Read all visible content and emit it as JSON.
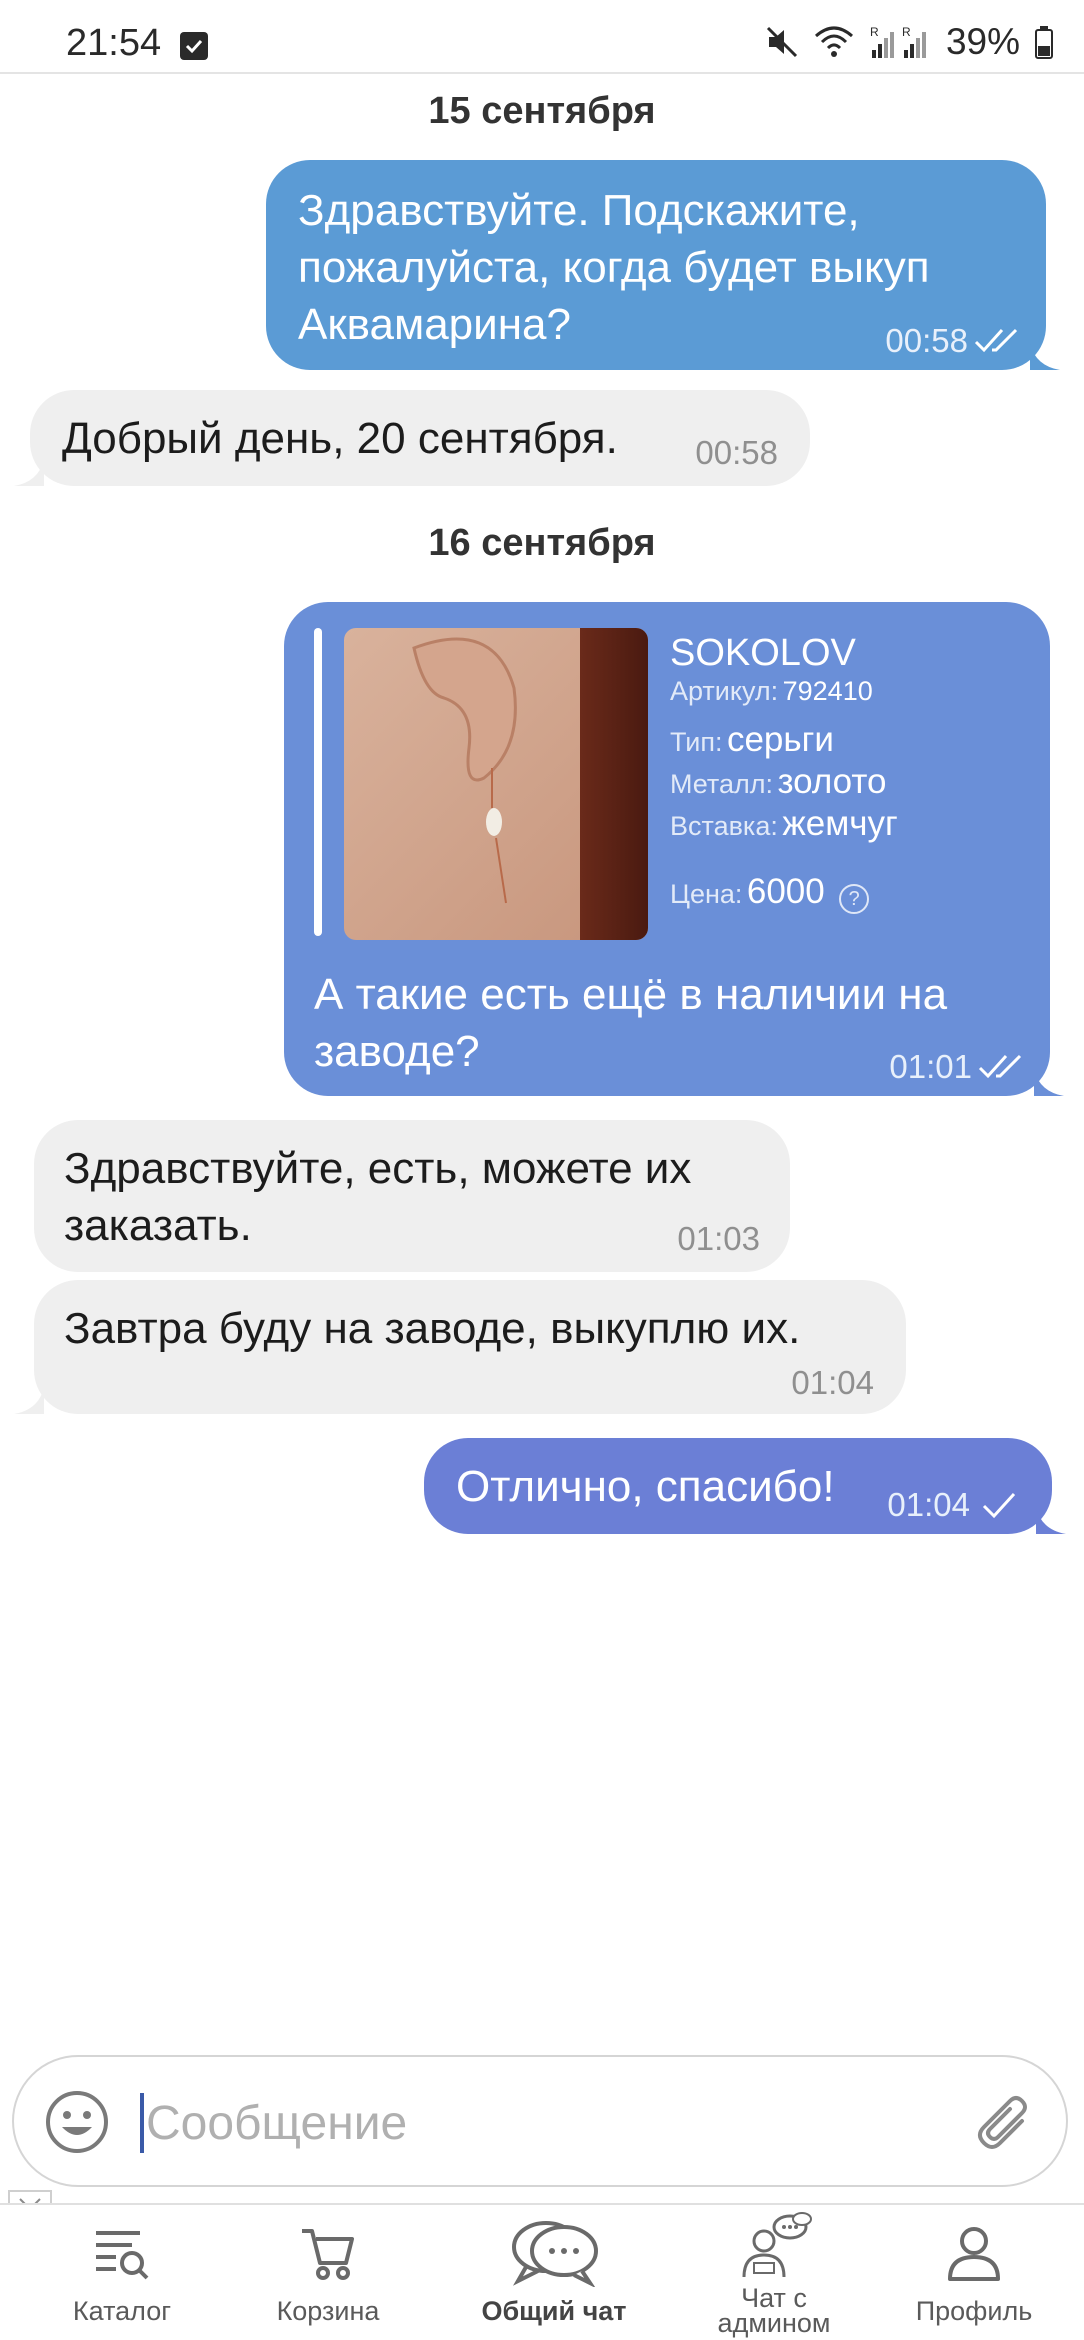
{
  "status_bar": {
    "time": "21:54",
    "battery": "39%",
    "icons": [
      "notification-check-icon",
      "mute-icon",
      "wifi-icon",
      "signal-icon",
      "battery-icon"
    ]
  },
  "chat": {
    "dates": [
      "15 сентября",
      "16 сентября"
    ],
    "messages": [
      {
        "direction": "out",
        "text": "Здравствуйте. Подскажите, пожалуйста, когда будет выкуп Аквамарина?",
        "time": "00:58",
        "status": "read"
      },
      {
        "direction": "in",
        "text": "Добрый день, 20 сентября.",
        "time": "00:58"
      },
      {
        "direction": "out",
        "product": {
          "brand": "SOKOLOV",
          "article_label": "Артикул:",
          "article": "792410",
          "type_label": "Тип:",
          "type": "серьги",
          "metal_label": "Металл:",
          "metal": "золото",
          "insert_label": "Вставка:",
          "insert": "жемчуг",
          "price_label": "Цена:",
          "price": "6000",
          "help": "?"
        },
        "text": "А такие есть ещё в наличии на заводе?",
        "time": "01:01",
        "status": "read"
      },
      {
        "direction": "in",
        "text": "Здравствуйте, есть, можете их заказать.",
        "time": "01:03"
      },
      {
        "direction": "in",
        "text": "Завтра буду на заводе, выкуплю их.",
        "time": "01:04"
      },
      {
        "direction": "out",
        "text": "Отлично, спасибо!",
        "time": "01:04",
        "status": "sent"
      }
    ]
  },
  "input": {
    "placeholder": "Сообщение",
    "value": ""
  },
  "nav": {
    "items": [
      {
        "label": "Каталог",
        "icon": "catalog-search-icon"
      },
      {
        "label": "Корзина",
        "icon": "cart-icon"
      },
      {
        "label": "Общий чат",
        "icon": "chat-bubbles-icon",
        "active": true
      },
      {
        "label_line1": "Чат с",
        "label_line2": "админом",
        "icon": "admin-chat-icon"
      },
      {
        "label": "Профиль",
        "icon": "profile-icon"
      }
    ]
  },
  "colors": {
    "outgoing_bubble": "#5b9bd5",
    "outgoing_bubble_product": "#6a8fd8",
    "outgoing_bubble_last": "#6b7fd6",
    "incoming_bubble": "#efefef"
  }
}
